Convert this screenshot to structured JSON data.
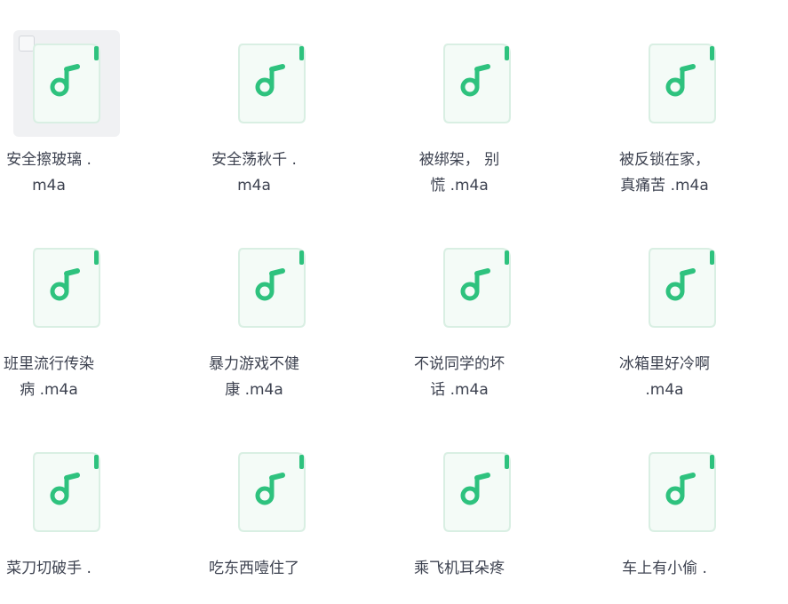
{
  "files": [
    {
      "line1": "安全擦玻璃 .",
      "line2": "m4a",
      "selected": true,
      "icon": "music-note-icon"
    },
    {
      "line1": "安全荡秋千 .",
      "line2": "m4a",
      "selected": false,
      "icon": "music-note-icon"
    },
    {
      "line1": "被绑架， 别",
      "line2": "慌 .m4a",
      "selected": false,
      "icon": "music-note-icon"
    },
    {
      "line1": "被反锁在家，",
      "line2": "真痛苦 .m4a",
      "selected": false,
      "icon": "music-note-icon"
    },
    {
      "line1": "班里流行传染",
      "line2": "病 .m4a",
      "selected": false,
      "icon": "music-note-icon"
    },
    {
      "line1": "暴力游戏不健",
      "line2": "康 .m4a",
      "selected": false,
      "icon": "music-note-icon"
    },
    {
      "line1": "不说同学的坏",
      "line2": "话 .m4a",
      "selected": false,
      "icon": "music-note-icon"
    },
    {
      "line1": "冰箱里好冷啊",
      "line2": ".m4a",
      "selected": false,
      "icon": "music-note-icon"
    },
    {
      "line1": "菜刀切破手 .",
      "line2": "",
      "selected": false,
      "icon": "music-note-icon"
    },
    {
      "line1": "吃东西噎住了",
      "line2": "",
      "selected": false,
      "icon": "music-note-icon"
    },
    {
      "line1": "乘飞机耳朵疼",
      "line2": "",
      "selected": false,
      "icon": "music-note-icon"
    },
    {
      "line1": "车上有小偷 .",
      "line2": "",
      "selected": false,
      "icon": "music-note-icon"
    }
  ],
  "colors": {
    "accent": "#2ec27e",
    "file_body": "#f4fbf7",
    "file_border": "#d9efe3",
    "selected_bg": "#f0f1f3",
    "text": "#3d4250"
  }
}
